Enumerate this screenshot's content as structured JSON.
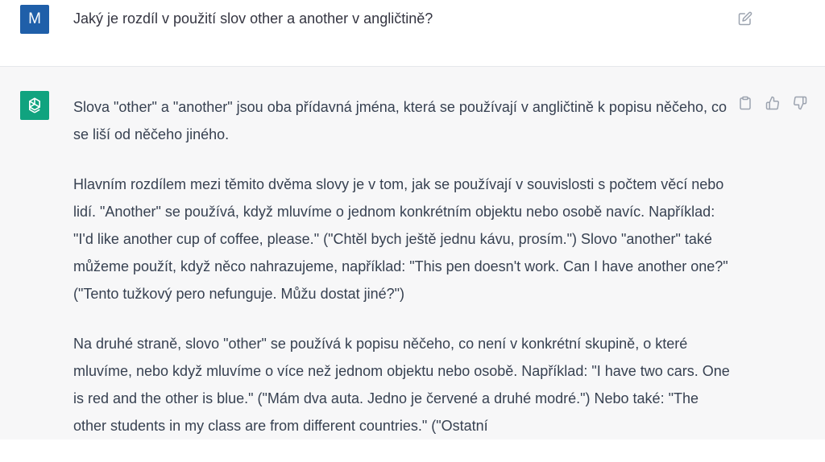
{
  "user": {
    "avatar_letter": "M",
    "message": "Jaký je rozdíl v použití slov other a another v angličtině?"
  },
  "assistant": {
    "paragraphs": [
      "Slova \"other\" a \"another\" jsou oba přídavná jména, která se používají v angličtině k popisu něčeho, co se liší od něčeho jiného.",
      "Hlavním rozdílem mezi těmito dvěma slovy je v tom, jak se používají v souvislosti s počtem věcí nebo lidí. \"Another\" se používá, když mluvíme o jednom konkrétním objektu nebo osobě navíc. Například: \"I'd like another cup of coffee, please.\" (\"Chtěl bych ještě jednu kávu, prosím.\") Slovo \"another\" také můžeme použít, když něco nahrazujeme, například: \"This pen doesn't work. Can I have another one?\" (\"Tento tužkový pero nefunguje. Můžu dostat jiné?\")",
      "Na druhé straně, slovo \"other\" se používá k popisu něčeho, co není v konkrétní skupině, o které mluvíme, nebo když mluvíme o více než jednom objektu nebo osobě. Například: \"I have two cars. One is red and the other is blue.\" (\"Mám dva auta. Jedno je červené a druhé modré.\") Nebo také: \"The other students in my class are from different countries.\" (\"Ostatní"
    ]
  },
  "icons": {
    "edit": "edit-icon",
    "copy": "clipboard-icon",
    "like": "thumbs-up-icon",
    "dislike": "thumbs-down-icon",
    "bot": "openai-logo-icon"
  },
  "colors": {
    "user_avatar": "#1f5fa9",
    "bot_avatar": "#10a37f",
    "assistant_bg": "#f7f7f8"
  }
}
